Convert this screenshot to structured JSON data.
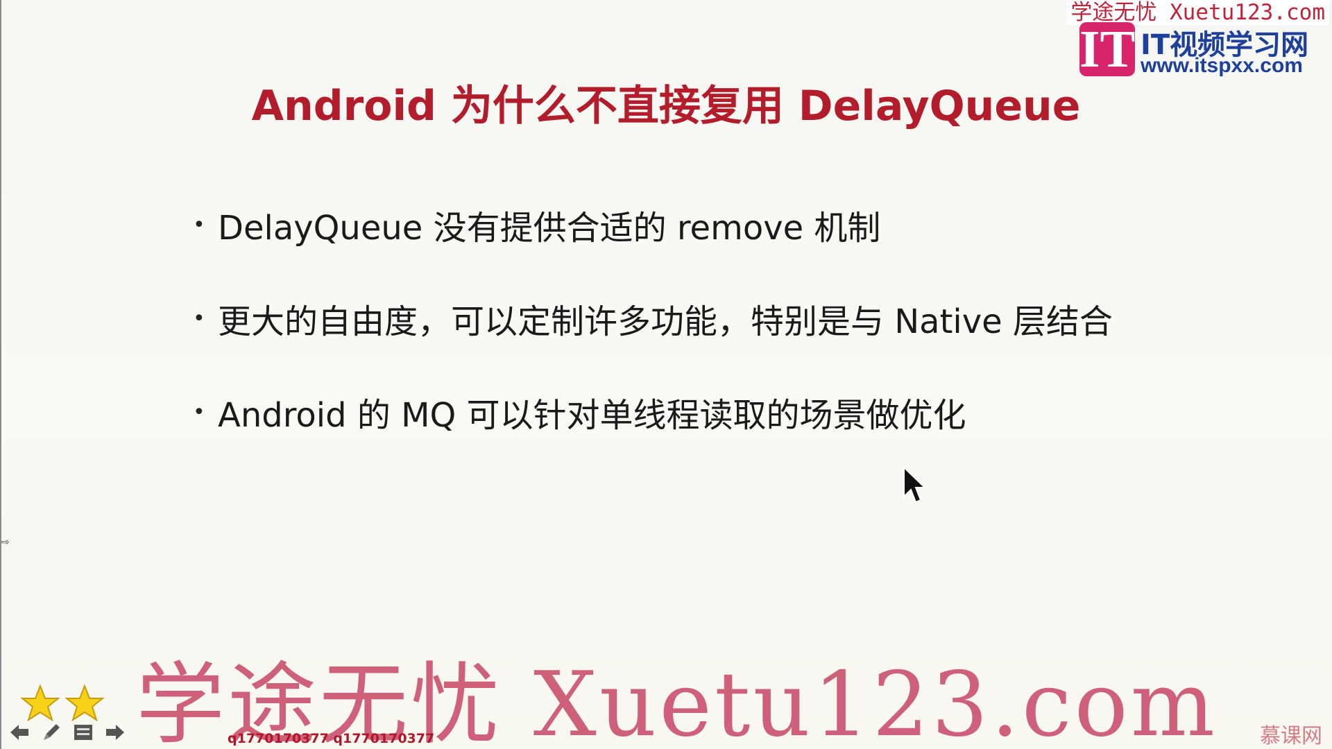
{
  "slide": {
    "title": "Android 为什么不直接复用 DelayQueue",
    "bullets": [
      "DelayQueue 没有提供合适的 remove 机制",
      "更大的自由度，可以定制许多功能，特别是与 Native 层结合",
      "Android 的 MQ 可以针对单线程读取的场景做优化"
    ],
    "bullet_symbol": "•"
  },
  "branding": {
    "top_line": "学途无忧 Xuetu123.com",
    "logo_letter": "IT",
    "site_name": "IT视频学习网",
    "site_url": "www.itspxx.com",
    "watermark": "学途无忧 Xuetu123.com",
    "qq": "q1770170377 q1770170377",
    "corner": "慕课网"
  },
  "toolbar": {
    "tools": [
      "back-arrow-icon",
      "pen-icon",
      "menu-icon",
      "forward-arrow-icon"
    ]
  },
  "colors": {
    "title": "#b31d2b",
    "text": "#1a1a1a",
    "brand_pink": "#d8246a",
    "brand_blue": "#1e3f9a",
    "watermark": "#c74664"
  },
  "misc": {
    "edge_mark": "⇨"
  }
}
